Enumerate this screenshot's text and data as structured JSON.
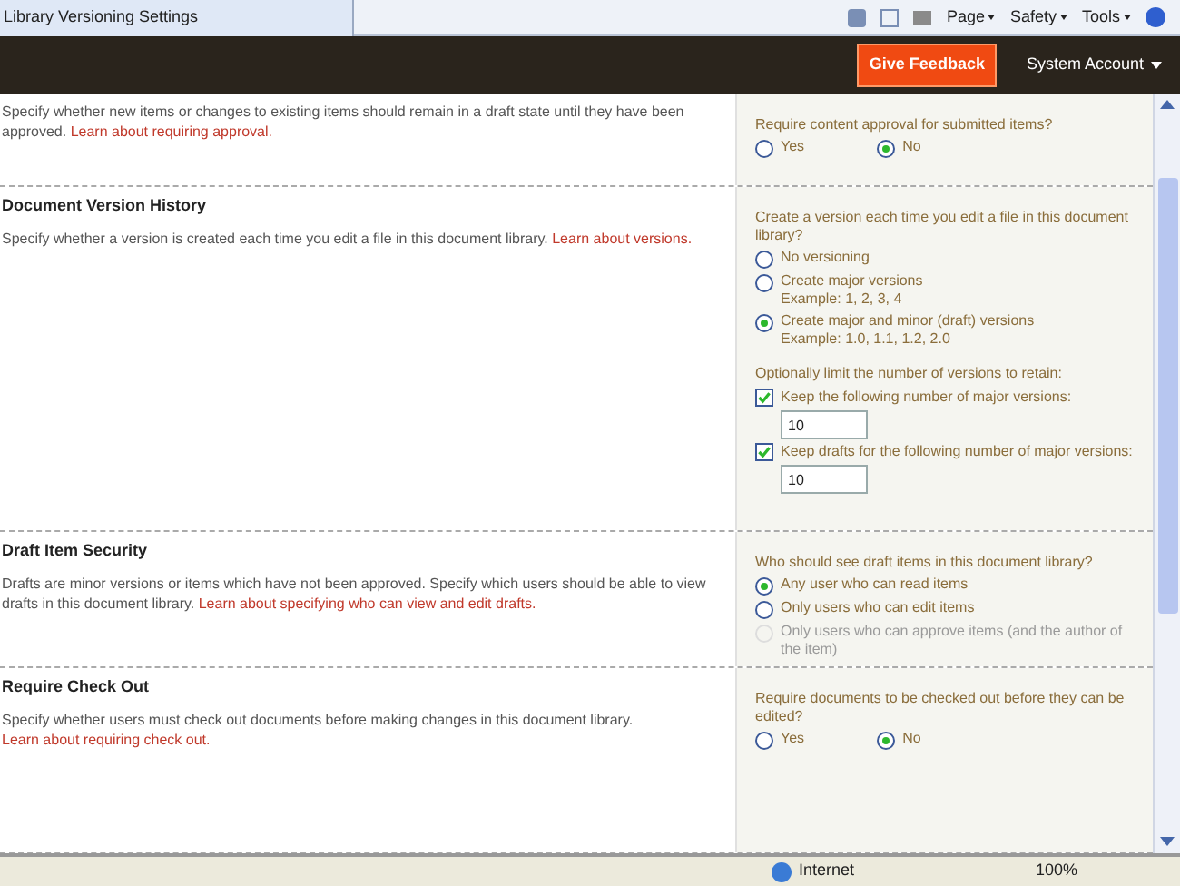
{
  "browser": {
    "tab_title": "Library Versioning Settings",
    "menus": [
      {
        "label": "Page"
      },
      {
        "label": "Safety"
      },
      {
        "label": "Tools"
      }
    ]
  },
  "header": {
    "feedback_button": "Give Feedback",
    "account": "System Account"
  },
  "sections": [
    {
      "description": "Specify whether new items or changes to existing items should remain in a draft state until they have been approved.",
      "link": "Learn about requiring approval.",
      "question": "Require content approval for submitted items?",
      "options": [
        {
          "label": "Yes",
          "selected": false,
          "disabled": false
        },
        {
          "label": "No",
          "selected": true,
          "disabled": false
        }
      ]
    },
    {
      "title": "Document Version History",
      "description": "Specify whether a version is created each time you edit a file in this document library.",
      "link": "Learn about versions.",
      "question": "Create a version each time you edit a file in this document library?",
      "options": [
        {
          "label": "No versioning",
          "selected": false,
          "disabled": false
        },
        {
          "label": "Create major versions",
          "example": "Example: 1, 2, 3, 4",
          "selected": false,
          "disabled": false
        },
        {
          "label": "Create major and minor (draft) versions",
          "example": "Example: 1.0, 1.1, 1.2, 2.0",
          "selected": true,
          "disabled": false
        }
      ],
      "limit_label": "Optionally limit the number of versions to retain:",
      "limits": [
        {
          "label": "Keep the following number of major versions:",
          "checked": true,
          "value": "10"
        },
        {
          "label": "Keep drafts for the following number of major versions:",
          "checked": true,
          "value": "10"
        }
      ]
    },
    {
      "title": "Draft Item Security",
      "description": "Drafts are minor versions or items which have not been approved. Specify which users should be able to view drafts in this document library.",
      "link": "Learn about specifying who can view and edit drafts.",
      "question": "Who should see draft items in this document library?",
      "options": [
        {
          "label": "Any user who can read items",
          "selected": true,
          "disabled": false
        },
        {
          "label": "Only users who can edit items",
          "selected": false,
          "disabled": false
        },
        {
          "label": "Only users who can approve items (and the author of the item)",
          "selected": false,
          "disabled": true
        }
      ]
    },
    {
      "title": "Require Check Out",
      "description": "Specify whether users must check out documents before making changes in this document library.",
      "link": "Learn about requiring check out.",
      "question": "Require documents to be checked out before they can be edited?",
      "options": [
        {
          "label": "Yes",
          "selected": false,
          "disabled": false
        },
        {
          "label": "No",
          "selected": true,
          "disabled": false
        }
      ]
    }
  ],
  "status_bar": {
    "zone": "Internet",
    "zoom": "100%"
  }
}
